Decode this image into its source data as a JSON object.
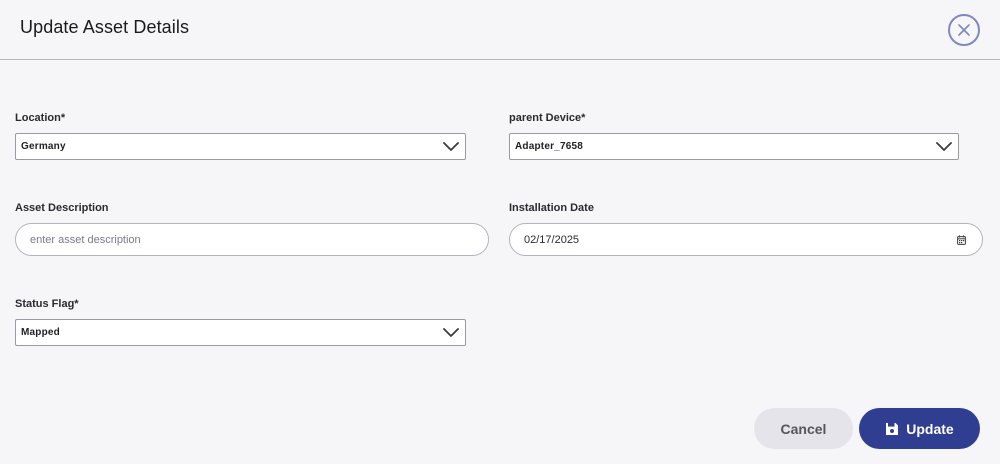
{
  "dialog": {
    "title": "Update Asset Details"
  },
  "form": {
    "location": {
      "label": "Location*",
      "value": "Germany"
    },
    "parent_device": {
      "label": "parent Device*",
      "value": "Adapter_7658"
    },
    "asset_description": {
      "label": "Asset Description",
      "placeholder": "enter asset description",
      "value": ""
    },
    "installation_date": {
      "label": "Installation Date",
      "value": "02/17/2025"
    },
    "status_flag": {
      "label": "Status Flag*",
      "value": "Mapped"
    }
  },
  "actions": {
    "cancel_label": "Cancel",
    "update_label": "Update"
  },
  "icons": {
    "close": "close-icon",
    "chevron": "chevron-down-icon",
    "calendar": "calendar-icon",
    "save": "save-icon"
  },
  "colors": {
    "accent": "#2f3e91",
    "close_ring": "#7f88bf",
    "cancel_bg": "#e4e4ea"
  }
}
